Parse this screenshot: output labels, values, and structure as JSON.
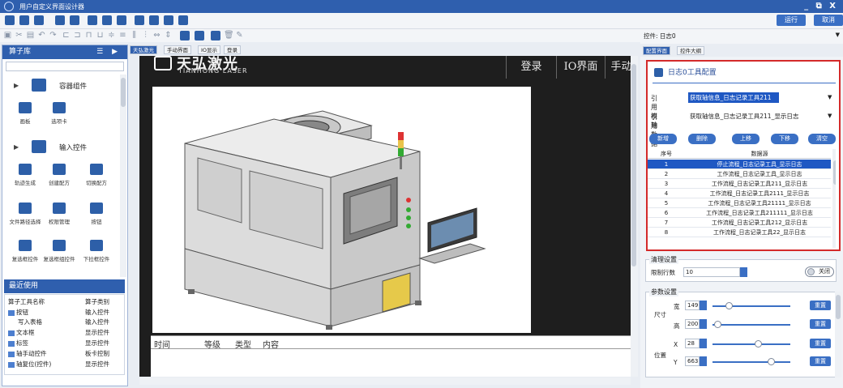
{
  "window": {
    "title": "用户自定义界面设计器"
  },
  "toolbar": {
    "run_label": "运行",
    "cancel_label": "取消"
  },
  "left_panel": {
    "title": "算子库",
    "categories": [
      {
        "label": "容器组件"
      },
      {
        "label": "输入控件"
      }
    ],
    "container_items": [
      "画板",
      "选项卡"
    ],
    "input_items": [
      "轨迹生成",
      "创建配方",
      "切换配方",
      "文件路径选择",
      "权限管理",
      "按钮",
      "复选框控件",
      "复选框组控件",
      "下拉框控件"
    ],
    "recent_title": "最近使用",
    "recent_header": {
      "name": "算子工具名称",
      "type": "算子类别"
    },
    "recent_rows": [
      {
        "name": "按钮",
        "type": "输入控件"
      },
      {
        "name": "写入表格",
        "type": "输入控件"
      },
      {
        "name": "文本框",
        "type": "显示控件"
      },
      {
        "name": "标签",
        "type": "显示控件"
      },
      {
        "name": "轴手动控件",
        "type": "板卡控制"
      },
      {
        "name": "轴复位(控件)",
        "type": "显示控件"
      }
    ]
  },
  "tabs": [
    "天弘激光",
    "手动界面",
    "IO显示",
    "登录"
  ],
  "canvas": {
    "brand_cn": "天弘激光",
    "brand_en": "TIANHONG LASER",
    "brand_small": "天弘激光",
    "nav": [
      "登录",
      "IO界面",
      "手动"
    ],
    "log_headers": [
      "时间",
      "等级",
      "类型",
      "内容"
    ]
  },
  "right_panel": {
    "control_label": "控件: 日志0",
    "tabs": [
      "配置界面",
      "控件大纲"
    ],
    "config_title": "日志0工具配置",
    "ref_axis_label": "引用模轴",
    "ref_axis_value": "获取轴信息_日志记录工具211",
    "ref_data_label": "引用数据",
    "ref_data_value": "获取轴信息_日志记录工具211_显示日志",
    "buttons": [
      "新增",
      "删除",
      "上移",
      "下移",
      "清空"
    ],
    "table_header": {
      "no": "序号",
      "source": "数据源"
    },
    "rows": [
      {
        "no": "1",
        "source": "停止流程_日志记录工具_显示日志"
      },
      {
        "no": "2",
        "source": "工作流程_日志记录工具_显示日志"
      },
      {
        "no": "3",
        "source": "工作流程_日志记录工具211_显示日志"
      },
      {
        "no": "4",
        "source": "工作流程_日志记录工具2111_显示日志"
      },
      {
        "no": "5",
        "source": "工作流程_日志记录工具21111_显示日志"
      },
      {
        "no": "6",
        "source": "工作流程_日志记录工具211111_显示日志"
      },
      {
        "no": "7",
        "source": "工作流程_日志记录工具212_显示日志"
      },
      {
        "no": "8",
        "source": "工作流程_日志记录工具22_显示日志"
      }
    ],
    "clear_section": {
      "title": "清理设置",
      "limit_label": "限制行数",
      "limit_value": "10",
      "toggle_label": "关闭"
    },
    "param_section": {
      "title": "参数设置",
      "size_label": "尺寸",
      "pos_label": "位置",
      "width_label": "宽",
      "width_value": "149",
      "height_label": "高",
      "height_value": "200",
      "x_label": "X",
      "x_value": "28",
      "y_label": "Y",
      "y_value": "663",
      "reset_label": "重置"
    }
  }
}
